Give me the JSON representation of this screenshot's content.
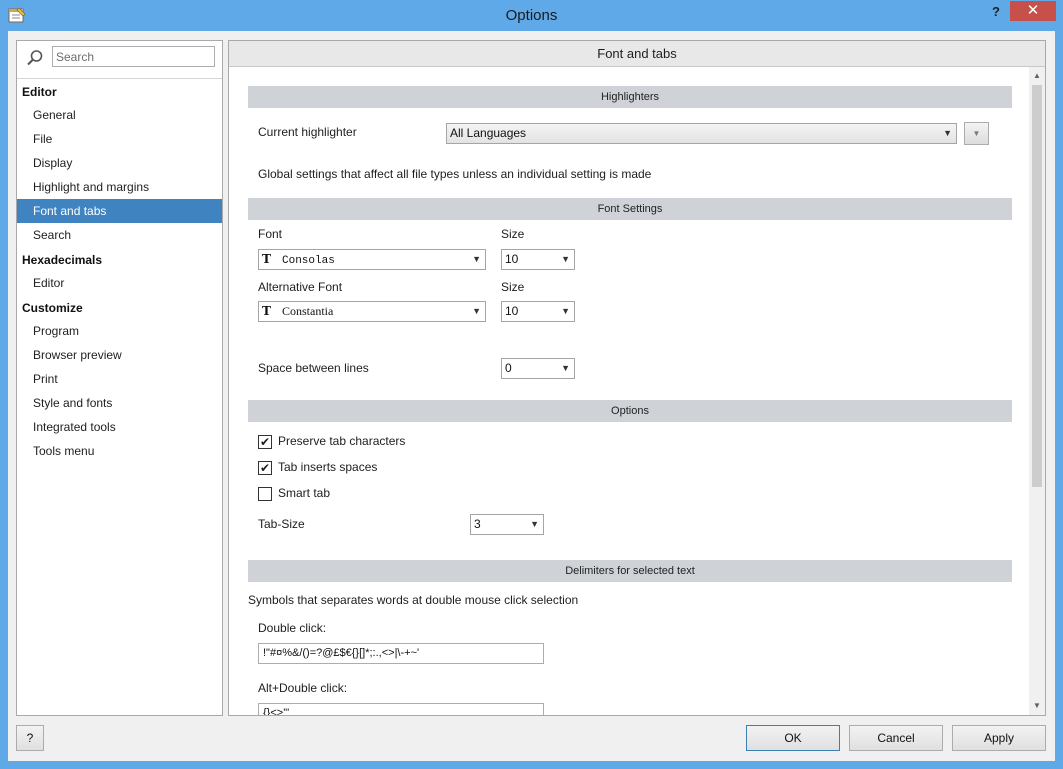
{
  "window": {
    "title": "Options",
    "help_label": "?",
    "close_label": "✕"
  },
  "search": {
    "placeholder": "Search"
  },
  "tree": {
    "editor_heading": "Editor",
    "editor_items": [
      "General",
      "File",
      "Display",
      "Highlight and margins",
      "Font and tabs",
      "Search"
    ],
    "hex_heading": "Hexadecimals",
    "hex_items": [
      "Editor"
    ],
    "customize_heading": "Customize",
    "customize_items": [
      "Program",
      "Browser preview",
      "Print",
      "Style and fonts",
      "Integrated tools",
      "Tools menu"
    ],
    "selected": "Font and tabs"
  },
  "panel": {
    "title": "Font and tabs"
  },
  "highlighters": {
    "section": "Highlighters",
    "current_label": "Current highlighter",
    "current_value": "All Languages",
    "description": "Global settings that affect all file types unless an individual setting is made"
  },
  "font_settings": {
    "section": "Font Settings",
    "font_label": "Font",
    "font_value": "Consolas",
    "size_label": "Size",
    "size_value": "10",
    "alt_font_label": "Alternative Font",
    "alt_font_value": "Constantia",
    "alt_size_label": "Size",
    "alt_size_value": "10",
    "spacing_label": "Space between lines",
    "spacing_value": "0",
    "font_glyph": "T"
  },
  "options": {
    "section": "Options",
    "preserve_tab_label": "Preserve tab characters",
    "preserve_tab_checked": true,
    "tab_inserts_label": "Tab inserts spaces",
    "tab_inserts_checked": true,
    "smart_tab_label": "Smart tab",
    "smart_tab_checked": false,
    "tab_size_label": "Tab-Size",
    "tab_size_value": "3",
    "check_mark": "✔"
  },
  "delimiters": {
    "section": "Delimiters for selected text",
    "description": "Symbols that separates words at double mouse click selection",
    "double_click_label": "Double click:",
    "double_click_value": "!\"#¤%&/()=?@£$€{}[]*;:.,<>|\\-+~'",
    "alt_double_click_label": "Alt+Double click:",
    "alt_double_click_value": "{}<>'\""
  },
  "buttons": {
    "help": "?",
    "ok": "OK",
    "cancel": "Cancel",
    "apply": "Apply"
  },
  "icons": {
    "dropdown": "▼",
    "scroll_up": "▲",
    "scroll_down": "▼"
  }
}
